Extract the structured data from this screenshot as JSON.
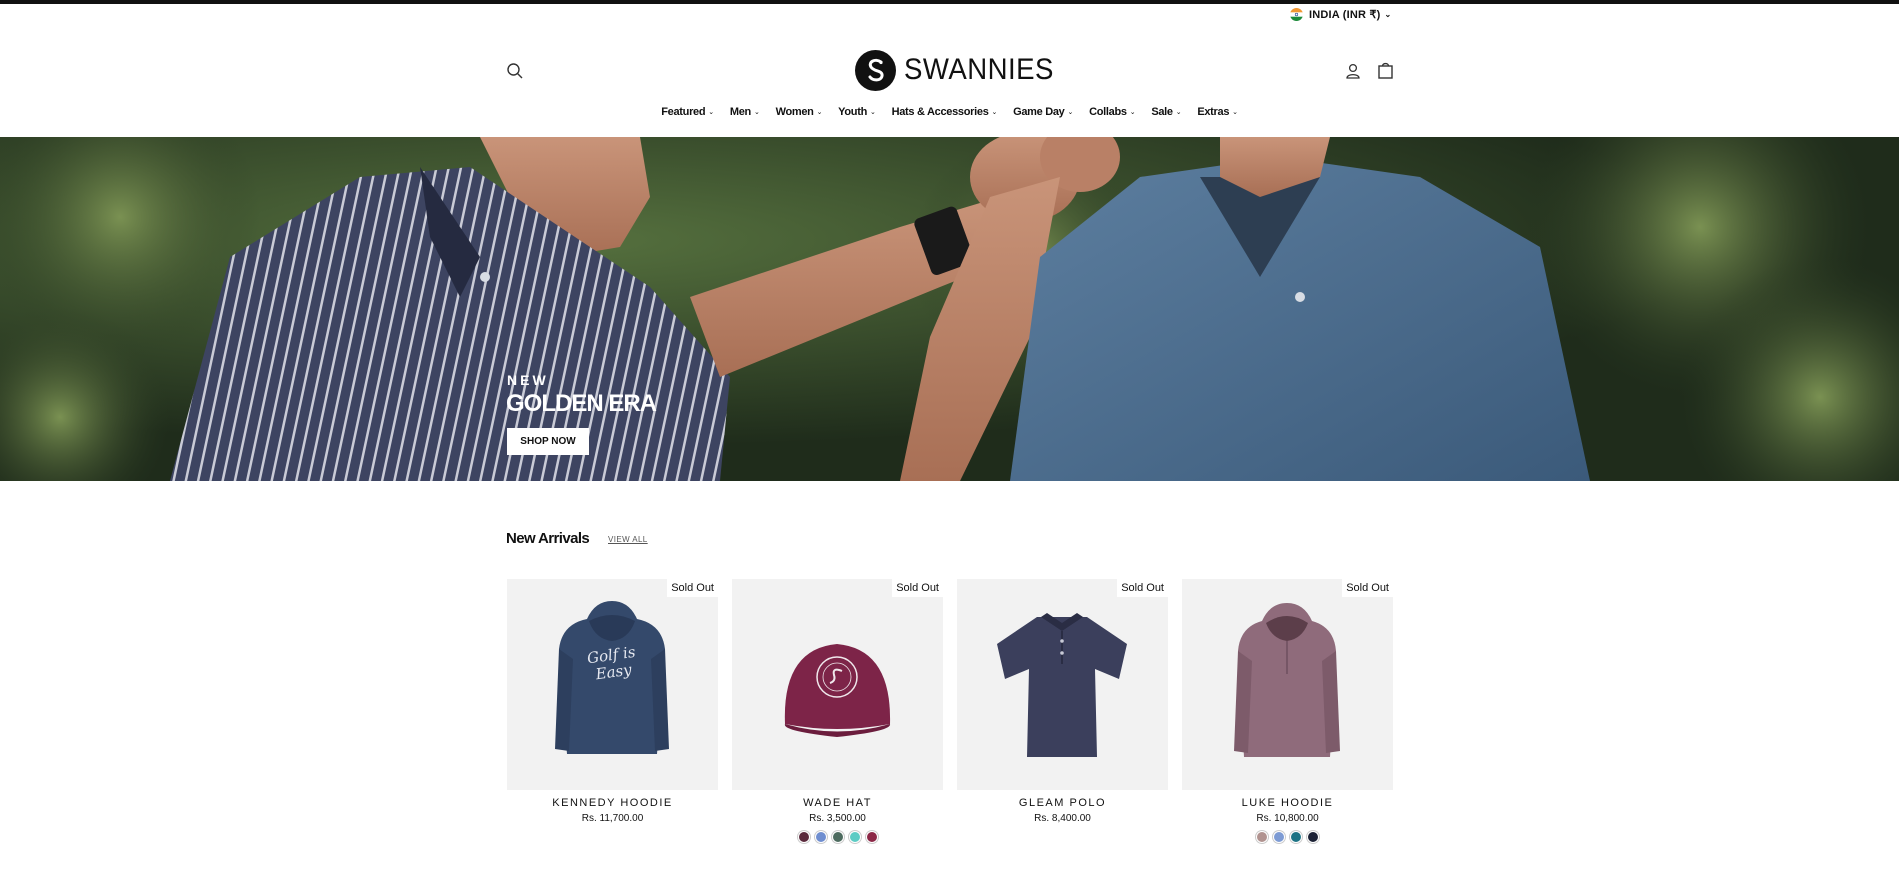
{
  "currency": {
    "label": "INDIA (INR ₹)"
  },
  "header": {
    "logo_text": "SWANNIES",
    "nav": [
      "Featured",
      "Men",
      "Women",
      "Youth",
      "Hats & Accessories",
      "Game Day",
      "Collabs",
      "Sale",
      "Extras"
    ]
  },
  "hero": {
    "kicker": "NEW",
    "title": "GOLDEN ERA",
    "cta": "SHOP NOW"
  },
  "new_arrivals": {
    "title": "New Arrivals",
    "view_all": "VIEW ALL",
    "products": [
      {
        "name": "KENNEDY HOODIE",
        "price": "Rs. 11,700.00",
        "badge": "Sold Out",
        "swatches": [],
        "image_text": "Golf is Easy"
      },
      {
        "name": "WADE HAT",
        "price": "Rs. 3,500.00",
        "badge": "Sold Out",
        "swatches": [
          "#5a2a3c",
          "#6f8ed0",
          "#4d6b5f",
          "#5ccbc4",
          "#8c2847"
        ]
      },
      {
        "name": "GLEAM POLO",
        "price": "Rs. 8,400.00",
        "badge": "Sold Out",
        "swatches": []
      },
      {
        "name": "LUKE HOODIE",
        "price": "Rs. 10,800.00",
        "badge": "Sold Out",
        "swatches": [
          "#b19390",
          "#7d9bd4",
          "#1d7385",
          "#1b2135"
        ]
      }
    ]
  }
}
